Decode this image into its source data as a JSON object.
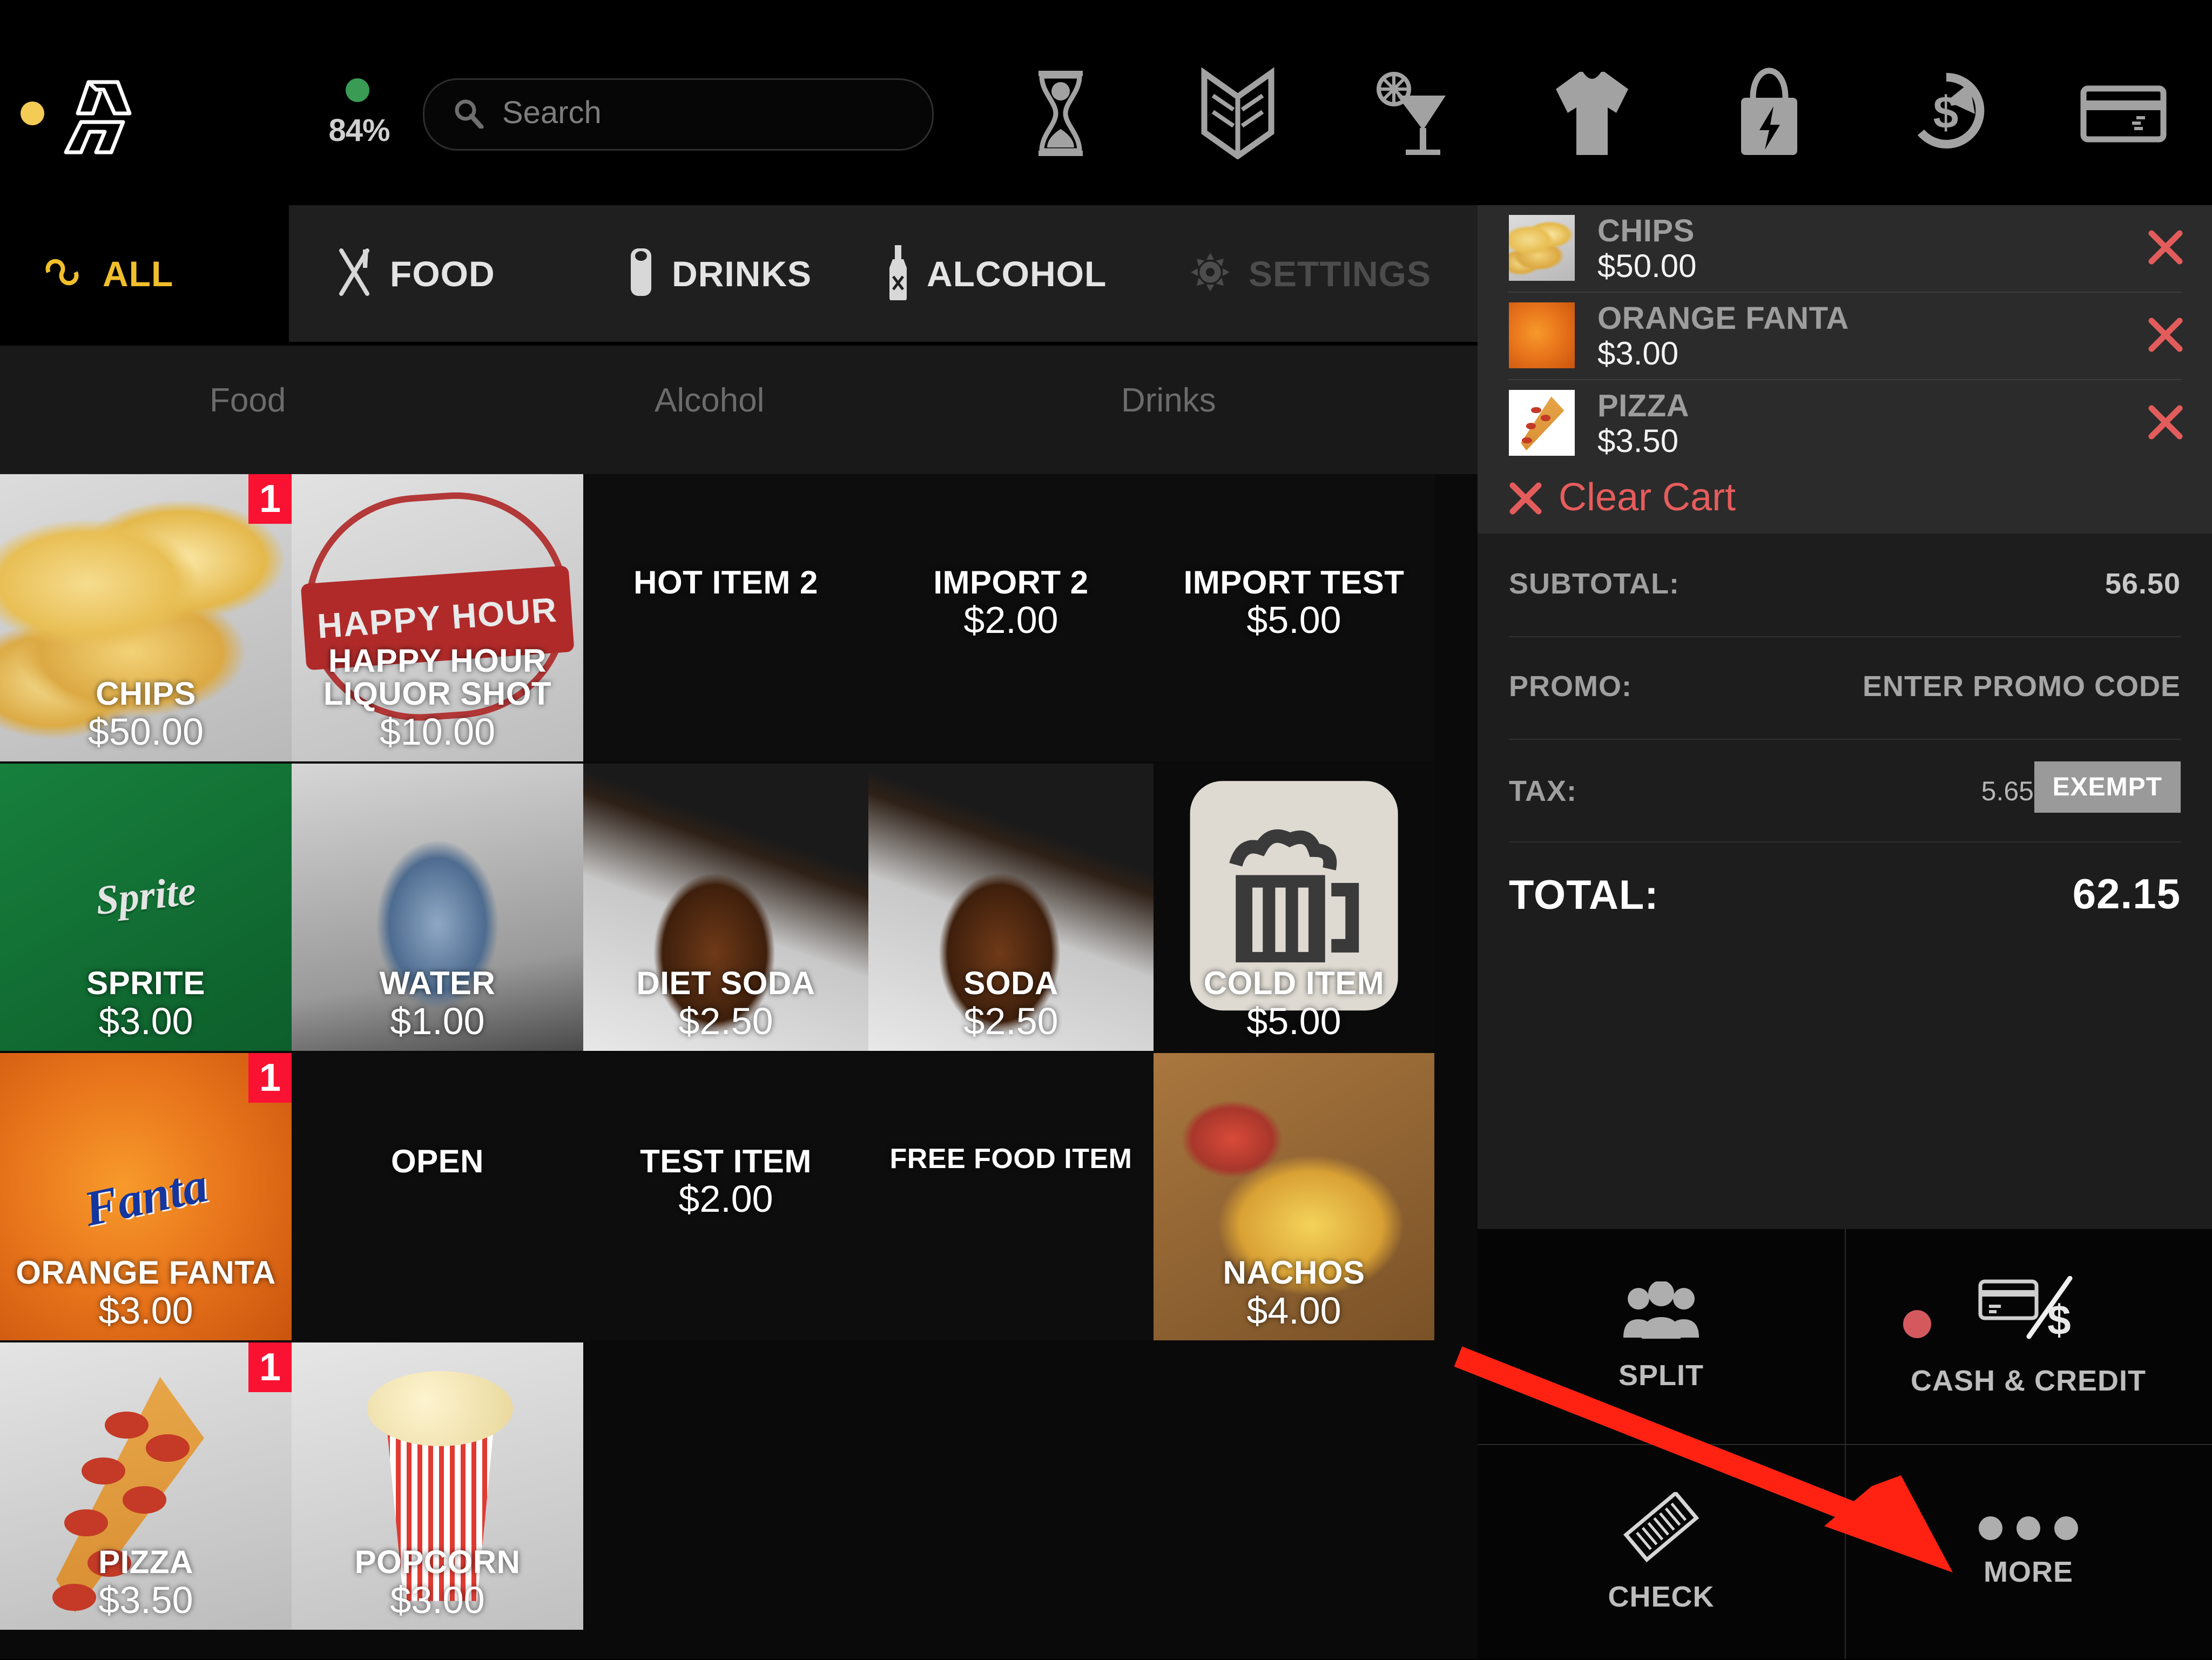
{
  "topbar": {
    "status_dot_color": "#f3cb55",
    "battery": {
      "percent": "84%",
      "dot_color": "#3a9b54"
    },
    "search": {
      "placeholder": "Search",
      "value": ""
    },
    "icons": [
      "hourglass-icon",
      "open-book-icon",
      "cocktail-icon",
      "tshirt-icon",
      "shopping-bag-bolt-icon",
      "dollar-refresh-icon",
      "credit-card-icon"
    ]
  },
  "tabs": {
    "active": "ALL",
    "items": [
      {
        "label": "ALL",
        "icon": "infinity-icon",
        "active": true,
        "disabled": false
      },
      {
        "label": "FOOD",
        "icon": "fork-knife-icon",
        "active": false,
        "disabled": false
      },
      {
        "label": "DRINKS",
        "icon": "soda-can-icon",
        "active": false,
        "disabled": false
      },
      {
        "label": "ALCOHOL",
        "icon": "bottle-icon",
        "active": false,
        "disabled": false
      },
      {
        "label": "SETTINGS",
        "icon": "gear-icon",
        "active": false,
        "disabled": true
      }
    ]
  },
  "subheader": {
    "items": [
      "Food",
      "Alcohol",
      "Drinks"
    ]
  },
  "grid": {
    "rows": [
      [
        {
          "name": "CHIPS",
          "price": "$50.00",
          "badge": "1",
          "art": "chips"
        },
        {
          "name": "HAPPY HOUR\nLIQUOR SHOT",
          "price": "$10.00",
          "badge": "",
          "art": "happyhour",
          "stamp_text": "HAPPY HOUR"
        },
        {
          "name": "HOT ITEM 2",
          "price": "",
          "badge": "",
          "art": "none"
        },
        {
          "name": "IMPORT 2",
          "price": "$2.00",
          "badge": "",
          "art": "none"
        },
        {
          "name": "IMPORT TEST",
          "price": "$5.00",
          "badge": "",
          "art": "none"
        }
      ],
      [
        {
          "name": "SPRITE",
          "price": "$3.00",
          "badge": "",
          "art": "sprite",
          "logo_text": "Sprite"
        },
        {
          "name": "WATER",
          "price": "$1.00",
          "badge": "",
          "art": "water"
        },
        {
          "name": "DIET SODA",
          "price": "$2.50",
          "badge": "",
          "art": "soda"
        },
        {
          "name": "SODA",
          "price": "$2.50",
          "badge": "",
          "art": "soda"
        },
        {
          "name": "COLD ITEM",
          "price": "$5.00",
          "badge": "",
          "art": "cold"
        }
      ],
      [
        {
          "name": "ORANGE FANTA",
          "price": "$3.00",
          "badge": "1",
          "art": "fanta",
          "logo_text": "Fanta"
        },
        {
          "name": "OPEN",
          "price": "",
          "badge": "",
          "art": "none"
        },
        {
          "name": "TEST ITEM",
          "price": "$2.00",
          "badge": "",
          "art": "none"
        },
        {
          "name": "FREE FOOD ITEM",
          "price": "",
          "badge": "",
          "art": "none"
        },
        {
          "name": "NACHOS",
          "price": "$4.00",
          "badge": "",
          "art": "nachos"
        }
      ],
      [
        {
          "name": "PIZZA",
          "price": "$3.50",
          "badge": "1",
          "art": "pizza"
        },
        {
          "name": "POPCORN",
          "price": "$3.00",
          "badge": "",
          "art": "popcorn"
        }
      ]
    ]
  },
  "cart": {
    "items": [
      {
        "name": "CHIPS",
        "price": "$50.00",
        "art": "chips",
        "remove_icon": "close-icon"
      },
      {
        "name": "ORANGE FANTA",
        "price": "$3.00",
        "art": "fanta",
        "remove_icon": "close-icon"
      },
      {
        "name": "PIZZA",
        "price": "$3.50",
        "art": "pizza",
        "remove_icon": "close-icon"
      }
    ],
    "clear_cart_label": "Clear Cart",
    "clear_cart_icon": "close-icon",
    "totals": {
      "subtotal_label": "SUBTOTAL:",
      "subtotal_value": "56.50",
      "promo_label": "PROMO:",
      "promo_value": "ENTER PROMO CODE",
      "tax_label": "TAX:",
      "tax_value": "5.65",
      "tax_exempt_label": "EXEMPT",
      "total_label": "TOTAL:",
      "total_value": "62.15"
    },
    "actions": [
      {
        "label": "SPLIT",
        "icon": "people-group-icon",
        "pip": false
      },
      {
        "label": "CASH & CREDIT",
        "icon": "card-slash-dollar-icon",
        "pip": true
      },
      {
        "label": "CHECK",
        "icon": "receipt-icon",
        "pip": false
      },
      {
        "label": "MORE",
        "icon": "ellipsis-icon",
        "pip": false
      }
    ]
  },
  "annotation": {
    "arrow_color": "#ff2212",
    "arrow_from": "split-button-left",
    "arrow_to": "more-button"
  },
  "colors": {
    "accent_yellow": "#f3cb55",
    "badge_red": "#fa1233",
    "clear_red": "#e75c5c",
    "panel_bg": "#2b2b2b",
    "totals_bg": "#1d1d1d"
  }
}
